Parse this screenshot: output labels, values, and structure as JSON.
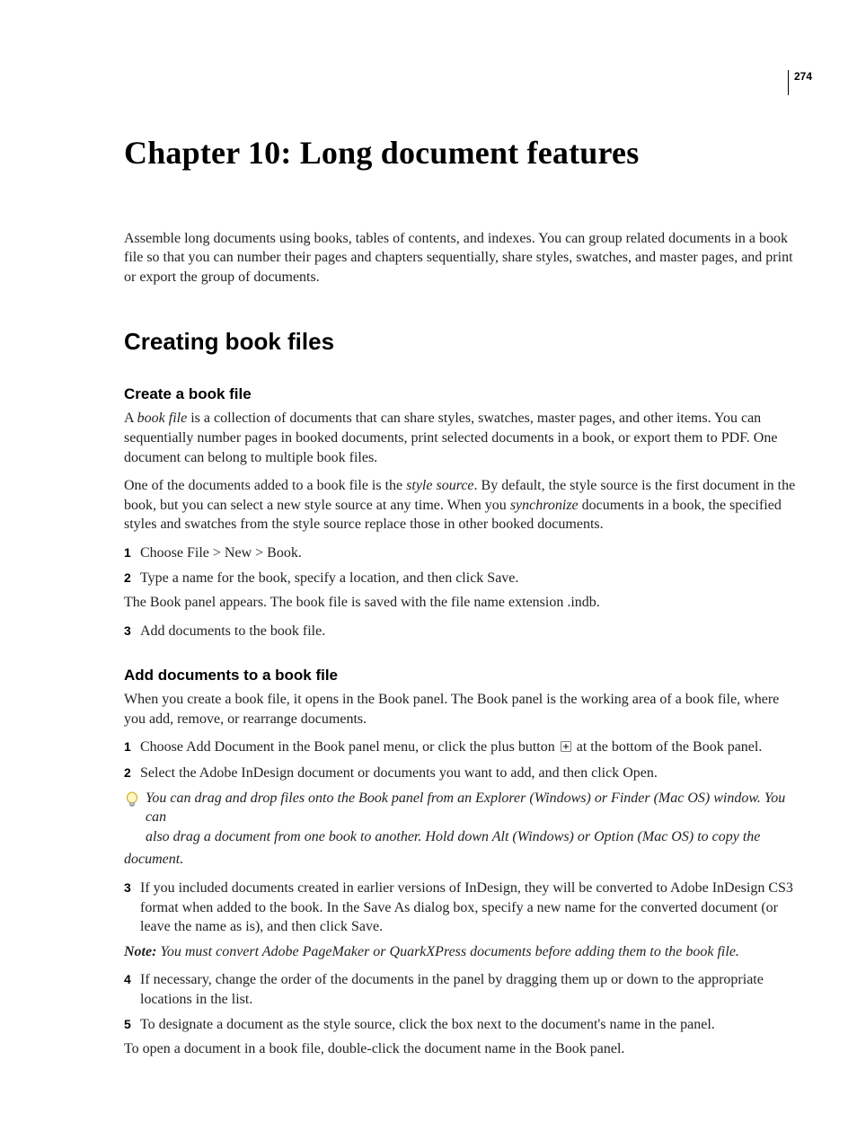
{
  "page_number": "274",
  "chapter_title": "Chapter 10: Long document features",
  "intro": "Assemble long documents using books, tables of contents, and indexes. You can group related documents in a book file so that you can number their pages and chapters sequentially, share styles, swatches, and master pages, and print or export the group of documents.",
  "section": "Creating book files",
  "sub1": {
    "title": "Create a book file",
    "p1a": "A ",
    "p1b_italic": "book file",
    "p1c": " is a collection of documents that can share styles, swatches, master pages, and other items. You can sequentially number pages in booked documents, print selected documents in a book, or export them to PDF. One document can belong to multiple book files.",
    "p2a": "One of the documents added to a book file is the ",
    "p2b_italic": "style source",
    "p2c": ". By default, the style source is the first document in the book, but you can select a new style source at any time. When you ",
    "p2d_italic": "synchronize",
    "p2e": " documents in a book, the specified styles and swatches from the style source replace those in other booked documents.",
    "step1_num": "1",
    "step1": "Choose File > New > Book.",
    "step2_num": "2",
    "step2": "Type a name for the book, specify a location, and then click Save.",
    "p3": "The Book panel appears. The book file is saved with the file name extension .indb.",
    "step3_num": "3",
    "step3": "Add documents to the book file."
  },
  "sub2": {
    "title": "Add documents to a book file",
    "p1": "When you create a book file, it opens in the Book panel. The Book panel is the working area of a book file, where you add, remove, or rearrange documents.",
    "step1_num": "1",
    "step1a": "Choose Add Document in the Book panel menu, or click the plus button ",
    "step1b": " at the bottom of the Book panel.",
    "step2_num": "2",
    "step2": "Select the Adobe InDesign document or documents you want to add, and then click Open.",
    "tip_line1": "You can drag and drop files onto the Book panel from an Explorer (Windows) or Finder (Mac OS) window. You can",
    "tip_line2": "also drag a document from one book to another. Hold down Alt (Windows) or Option (Mac OS) to copy the",
    "tip_line3": "document.",
    "step3_num": "3",
    "step3": "If you included documents created in earlier versions of InDesign, they will be converted to Adobe InDesign CS3 format when added to the book. In the Save As dialog box, specify a new name for the converted document (or leave the name as is), and then click Save.",
    "note_label": "Note:",
    "note_text": " You must convert Adobe PageMaker or QuarkXPress documents before adding them to the book file.",
    "step4_num": "4",
    "step4": "If necessary, change the order of the documents in the panel by dragging them up or down to the appropriate locations in the list.",
    "step5_num": "5",
    "step5": "To designate a document as the style source, click the box next to the document's name in the panel.",
    "p_last": "To open a document in a book file, double-click the document name in the Book panel."
  }
}
